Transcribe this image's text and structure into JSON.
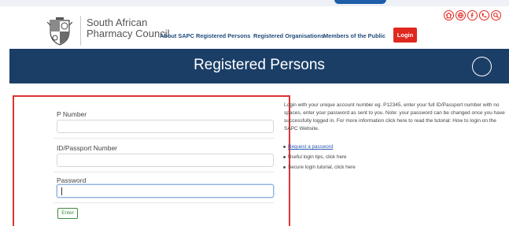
{
  "brand": {
    "line1": "South African",
    "line2": "Pharmacy Council"
  },
  "nav": {
    "items": [
      "About SAPC",
      "Registered Persons",
      "Registered Organisations",
      "Members of the Public"
    ],
    "login_label": "Login"
  },
  "social_icons": [
    "home-icon",
    "globe-icon",
    "facebook-icon",
    "phone-icon",
    "search-icon"
  ],
  "colors": {
    "accent_red": "#e0281e",
    "banner_navy": "#1b3e67",
    "link_blue": "#2d59b3",
    "enter_green": "#3c8c3c"
  },
  "banner": {
    "title": "Registered Persons"
  },
  "form": {
    "p_number_label": "P Number",
    "p_number_value": "",
    "id_label": "ID/Passport Number",
    "id_value": "",
    "password_label": "Password",
    "password_value": "",
    "enter_label": "Enter"
  },
  "info": {
    "text": "Login with your unique account number eg. P12345, enter your full ID/Passport number with no spaces, enter your password as sent to you. Note: your password can be changed once you have successfully logged in. For more information click here to read the tutorial: How to login on the SAPC Website.",
    "links": [
      "Request a password",
      "Useful login tips, click here",
      "Secure login tutorial, click here"
    ]
  }
}
